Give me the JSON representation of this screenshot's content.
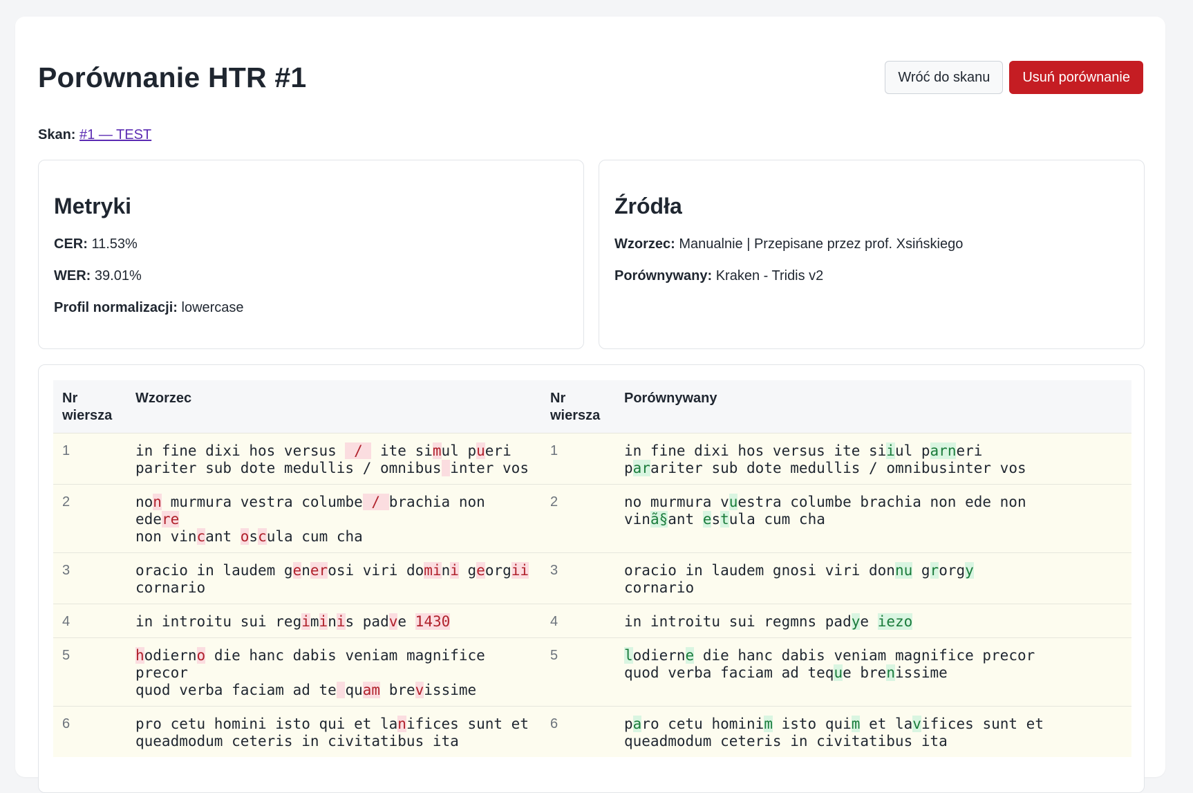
{
  "header": {
    "title": "Porównanie HTR #1",
    "back_button": "Wróć do skanu",
    "delete_button": "Usuń porównanie"
  },
  "scan": {
    "label": "Skan:",
    "link_text": "#1 — TEST"
  },
  "metrics": {
    "heading": "Metryki",
    "cer_label": "CER:",
    "cer_value": "11.53%",
    "wer_label": "WER:",
    "wer_value": "39.01%",
    "profile_label": "Profil normalizacji:",
    "profile_value": "lowercase"
  },
  "sources": {
    "heading": "Źródła",
    "reference_label": "Wzorzec:",
    "reference_value": "Manualnie | Przepisane przez prof. Xsińskiego",
    "hypothesis_label": "Porównywany:",
    "hypothesis_value": "Kraken - Tridis v2"
  },
  "table": {
    "col_line_left": "Nr wiersza",
    "col_reference": "Wzorzec",
    "col_line_right": "Nr wiersza",
    "col_hypothesis": "Porównywany",
    "rows": [
      {
        "nr": "1",
        "ref": [
          [
            "in fine dixi hos versus ",
            ""
          ],
          [
            " / ",
            "d"
          ],
          [
            " ite si",
            ""
          ],
          [
            "m",
            "d"
          ],
          [
            "ul p",
            ""
          ],
          [
            "u",
            "d"
          ],
          [
            "eri\npariter sub dote medullis / omnibus",
            ""
          ],
          [
            " ",
            "d"
          ],
          [
            "inter vos",
            ""
          ]
        ],
        "hyp": [
          [
            "in fine dixi hos versus ite si",
            ""
          ],
          [
            "i",
            "i"
          ],
          [
            "ul p",
            ""
          ],
          [
            "arn",
            "i"
          ],
          [
            "eri\np",
            ""
          ],
          [
            "ar",
            "i"
          ],
          [
            "ariter sub dote medullis / omnibusinter vos",
            ""
          ]
        ]
      },
      {
        "nr": "2",
        "ref": [
          [
            "no",
            ""
          ],
          [
            "n",
            "d"
          ],
          [
            " murmura vestra columbe",
            ""
          ],
          [
            " / ",
            "d"
          ],
          [
            "brachia non ede",
            ""
          ],
          [
            "re",
            "d"
          ],
          [
            "\nnon vin",
            ""
          ],
          [
            "c",
            "d"
          ],
          [
            "ant ",
            ""
          ],
          [
            "o",
            "d"
          ],
          [
            "s",
            ""
          ],
          [
            "c",
            "d"
          ],
          [
            "ula cum cha",
            ""
          ]
        ],
        "hyp": [
          [
            "no murmura v",
            ""
          ],
          [
            "u",
            "i"
          ],
          [
            "estra columbe brachia non ede non\nvin",
            ""
          ],
          [
            "ã§",
            "i"
          ],
          [
            "ant ",
            ""
          ],
          [
            "e",
            "i"
          ],
          [
            "s",
            ""
          ],
          [
            "t",
            "i"
          ],
          [
            "ula cum cha",
            ""
          ]
        ]
      },
      {
        "nr": "3",
        "ref": [
          [
            "oracio in laudem g",
            ""
          ],
          [
            "e",
            "d"
          ],
          [
            "n",
            ""
          ],
          [
            "er",
            "d"
          ],
          [
            "osi viri do",
            ""
          ],
          [
            "mi",
            "d"
          ],
          [
            "n",
            ""
          ],
          [
            "i",
            "d"
          ],
          [
            " g",
            ""
          ],
          [
            "e",
            "d"
          ],
          [
            "org",
            ""
          ],
          [
            "ii",
            "d"
          ],
          [
            "\ncornario",
            ""
          ]
        ],
        "hyp": [
          [
            "oracio in laudem gnosi viri don",
            ""
          ],
          [
            "nu",
            "i"
          ],
          [
            " g",
            ""
          ],
          [
            "r",
            "i"
          ],
          [
            "org",
            ""
          ],
          [
            "y",
            "i"
          ],
          [
            "\ncornario",
            ""
          ]
        ]
      },
      {
        "nr": "4",
        "ref": [
          [
            "in introitu sui reg",
            ""
          ],
          [
            "i",
            "d"
          ],
          [
            "m",
            ""
          ],
          [
            "i",
            "d"
          ],
          [
            "n",
            ""
          ],
          [
            "i",
            "d"
          ],
          [
            "s pad",
            ""
          ],
          [
            "v",
            "d"
          ],
          [
            "e ",
            ""
          ],
          [
            "1430",
            "d"
          ]
        ],
        "hyp": [
          [
            "in introitu sui regmns pad",
            ""
          ],
          [
            "y",
            "i"
          ],
          [
            "e ",
            ""
          ],
          [
            "iezo",
            "i"
          ]
        ]
      },
      {
        "nr": "5",
        "ref": [
          [
            "h",
            "d"
          ],
          [
            "odiern",
            ""
          ],
          [
            "o",
            "d"
          ],
          [
            " die hanc dabis veniam magnifice precor\nquod verba faciam ad te",
            ""
          ],
          [
            " ",
            "d"
          ],
          [
            "qu",
            ""
          ],
          [
            "am",
            "d"
          ],
          [
            " bre",
            ""
          ],
          [
            "v",
            "d"
          ],
          [
            "issime",
            ""
          ]
        ],
        "hyp": [
          [
            "l",
            "i"
          ],
          [
            "odiern",
            ""
          ],
          [
            "e",
            "i"
          ],
          [
            " die hanc dabis veniam magnifice precor\nquod verba faciam ad teq",
            ""
          ],
          [
            "u",
            "i"
          ],
          [
            "e bre",
            ""
          ],
          [
            "n",
            "i"
          ],
          [
            "issime",
            ""
          ]
        ]
      },
      {
        "nr": "6",
        "ref": [
          [
            "pro cetu homini isto qui et la",
            ""
          ],
          [
            "n",
            "d"
          ],
          [
            "ifices sunt et\nqueadmodum ceteris in civitatibus ita",
            ""
          ]
        ],
        "hyp": [
          [
            "p",
            ""
          ],
          [
            "a",
            "i"
          ],
          [
            "ro cetu homini",
            ""
          ],
          [
            "m",
            "i"
          ],
          [
            " isto qui",
            ""
          ],
          [
            "m",
            "i"
          ],
          [
            " et la",
            ""
          ],
          [
            "v",
            "i"
          ],
          [
            "ifices sunt et\nqueadmodum ceteris in civitatibus ita",
            ""
          ]
        ]
      }
    ]
  },
  "colors": {
    "danger": "#c51d23",
    "link": "#5b2bb3",
    "deleted_bg": "#fbdde0",
    "inserted_bg": "#d9f5e1",
    "row_bg": "#fdfcef"
  }
}
